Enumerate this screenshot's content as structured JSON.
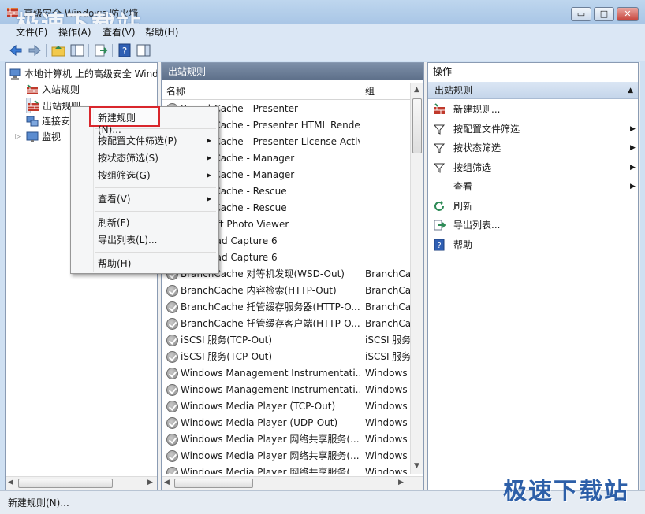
{
  "window": {
    "title": "高级安全 Windows 防火墙",
    "watermark_top": "极速下载站",
    "watermark_bottom": "极速下载站",
    "minimize": "▭",
    "maximize": "□",
    "close": "✕"
  },
  "menubar": [
    "文件(F)",
    "操作(A)",
    "查看(V)",
    "帮助(H)"
  ],
  "tree": {
    "root": "本地计算机 上的高级安全 Windows 防火墙",
    "items": [
      "入站规则",
      "出站规则",
      "连接安全规则",
      "监视"
    ]
  },
  "list": {
    "header": "出站规则",
    "columns": [
      "名称",
      "组"
    ],
    "rows": [
      {
        "name": "BranchCache - Presenter",
        "group": ""
      },
      {
        "name": "BranchCache - Presenter HTML Renderer",
        "group": ""
      },
      {
        "name": "BranchCache - Presenter License Activator",
        "group": ""
      },
      {
        "name": "BranchCache - Manager",
        "group": ""
      },
      {
        "name": "BranchCache - Manager",
        "group": ""
      },
      {
        "name": "BranchCache - Rescue",
        "group": ""
      },
      {
        "name": "BranchCache - Rescue",
        "group": ""
      },
      {
        "name": "Microsoft Photo Viewer",
        "group": ""
      },
      {
        "name": "Download Capture 6",
        "group": ""
      },
      {
        "name": "Download Capture 6",
        "group": ""
      },
      {
        "name": "BranchCache 对等机发现(WSD-Out)",
        "group": "BranchCache"
      },
      {
        "name": "BranchCache 内容检索(HTTP-Out)",
        "group": "BranchCache"
      },
      {
        "name": "BranchCache 托管缓存服务器(HTTP-O...",
        "group": "BranchCache"
      },
      {
        "name": "BranchCache 托管缓存客户端(HTTP-O...",
        "group": "BranchCache"
      },
      {
        "name": "iSCSI 服务(TCP-Out)",
        "group": "iSCSI 服务"
      },
      {
        "name": "iSCSI 服务(TCP-Out)",
        "group": "iSCSI 服务"
      },
      {
        "name": "Windows Management Instrumentati...",
        "group": "Windows"
      },
      {
        "name": "Windows Management Instrumentati...",
        "group": "Windows"
      },
      {
        "name": "Windows Media Player (TCP-Out)",
        "group": "Windows"
      },
      {
        "name": "Windows Media Player (UDP-Out)",
        "group": "Windows"
      },
      {
        "name": "Windows Media Player 网络共享服务(...",
        "group": "Windows"
      },
      {
        "name": "Windows Media Player 网络共享服务(...",
        "group": "Windows"
      },
      {
        "name": "Windows Media Player 网络共享服务(...",
        "group": "Windows"
      }
    ]
  },
  "actions": {
    "header": "操作",
    "subheader": "出站规则",
    "items": [
      {
        "label": "新建规则...",
        "arrow": false
      },
      {
        "label": "按配置文件筛选",
        "arrow": true
      },
      {
        "label": "按状态筛选",
        "arrow": true
      },
      {
        "label": "按组筛选",
        "arrow": true
      },
      {
        "label": "查看",
        "arrow": true
      },
      {
        "label": "刷新",
        "arrow": false
      },
      {
        "label": "导出列表...",
        "arrow": false
      },
      {
        "label": "帮助",
        "arrow": false
      }
    ]
  },
  "context_menu": {
    "items": [
      {
        "label": "新建规则(N)...",
        "arrow": false
      },
      {
        "label": "按配置文件筛选(P)",
        "arrow": true
      },
      {
        "label": "按状态筛选(S)",
        "arrow": true
      },
      {
        "label": "按组筛选(G)",
        "arrow": true
      },
      {
        "label": "查看(V)",
        "arrow": true
      },
      {
        "label": "刷新(F)",
        "arrow": false
      },
      {
        "label": "导出列表(L)...",
        "arrow": false
      },
      {
        "label": "帮助(H)",
        "arrow": false
      }
    ],
    "arrow_glyph": "▶"
  },
  "statusbar": {
    "text": "新建规则(N)..."
  },
  "icons": {
    "back": "back-arrow-icon",
    "forward": "forward-arrow-icon",
    "up": "up-folder-icon",
    "show_tree": "show-hide-tree-icon",
    "export": "export-list-icon",
    "help": "help-icon",
    "action_pane": "show-action-pane-icon"
  }
}
